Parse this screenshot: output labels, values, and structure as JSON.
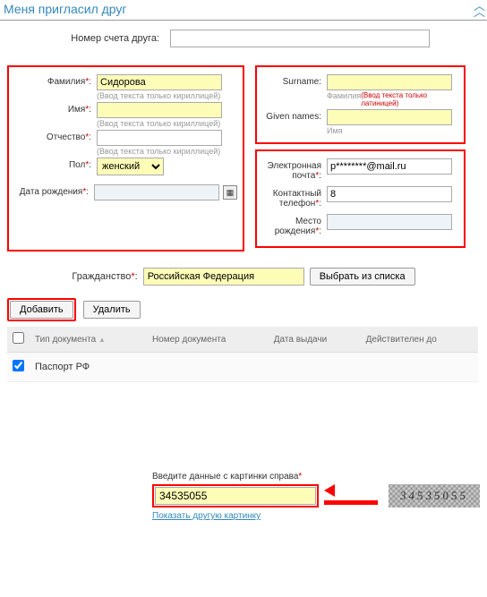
{
  "header": {
    "title": "Меня пригласил друг"
  },
  "friend": {
    "label": "Номер счета друга:",
    "value": ""
  },
  "left": {
    "surname_label": "Фамилия",
    "surname_value": "Сидорова",
    "surname_hint": "(Ввод текста только кириллицей)",
    "name_label": "Имя",
    "name_value": "",
    "name_hint": "(Ввод текста только кириллицей)",
    "patronymic_label": "Отчество",
    "patronymic_value": "",
    "patronymic_hint": "(Ввод текста только кириллицей)",
    "sex_label": "Пол",
    "sex_value": "женский",
    "dob_label": "Дата рождения",
    "dob_value": ""
  },
  "right_top": {
    "surname_label": "Surname:",
    "surname_value": "",
    "surname_hint_l": "Фамилия",
    "surname_hint_r": "(Ввод текста только латиницей)",
    "given_label": "Given names:",
    "given_value": "",
    "given_hint_l": "Имя"
  },
  "right_bot": {
    "email_label": "Электронная почта",
    "email_value": "p********@mail.ru",
    "phone_label": "Контактный телефон",
    "phone_value": "8",
    "place_label": "Место рождения",
    "place_value": ""
  },
  "citizen": {
    "label": "Гражданство",
    "value": "Российская Федерация",
    "pick": "Выбрать из списка"
  },
  "actions": {
    "add": "Добавить",
    "del": "Удалить"
  },
  "table": {
    "headers": {
      "type": "Тип документа",
      "number": "Номер документа",
      "issued": "Дата выдачи",
      "valid": "Действителен до"
    },
    "row": {
      "type": "Паспорт РФ",
      "number": "",
      "issued": "",
      "valid": ""
    }
  },
  "captcha": {
    "label": "Введите данные с картинки справа",
    "value": "34535055",
    "image_text": "34535055",
    "other": "Показать другую картинку"
  }
}
